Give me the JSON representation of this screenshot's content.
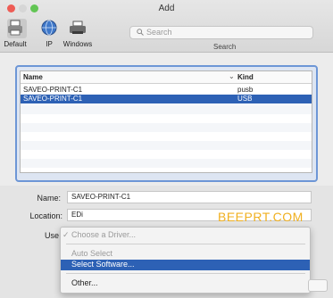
{
  "window": {
    "title": "Add"
  },
  "toolbar": {
    "default_label": "Default",
    "ip_label": "IP",
    "windows_label": "Windows",
    "search_placeholder": "Search",
    "search_caption": "Search"
  },
  "list": {
    "columns": {
      "name": "Name",
      "kind": "Kind"
    },
    "rows": [
      {
        "name": "SAVEO-PRINT-C1",
        "kind": "pusb",
        "selected": false
      },
      {
        "name": "SAVEO-PRINT-C1",
        "kind": "USB",
        "selected": true
      }
    ]
  },
  "form": {
    "name_label": "Name:",
    "name_value": "SAVEO-PRINT-C1",
    "location_label": "Location:",
    "location_value": "EDi",
    "use_label": "Use"
  },
  "watermark": "BEEPRT.COM",
  "use_menu": {
    "choose": "Choose a Driver...",
    "auto_select": "Auto Select",
    "select_software": "Select Software...",
    "other": "Other..."
  },
  "colors": {
    "selection": "#2d61b5",
    "watermark": "#f0b020"
  }
}
